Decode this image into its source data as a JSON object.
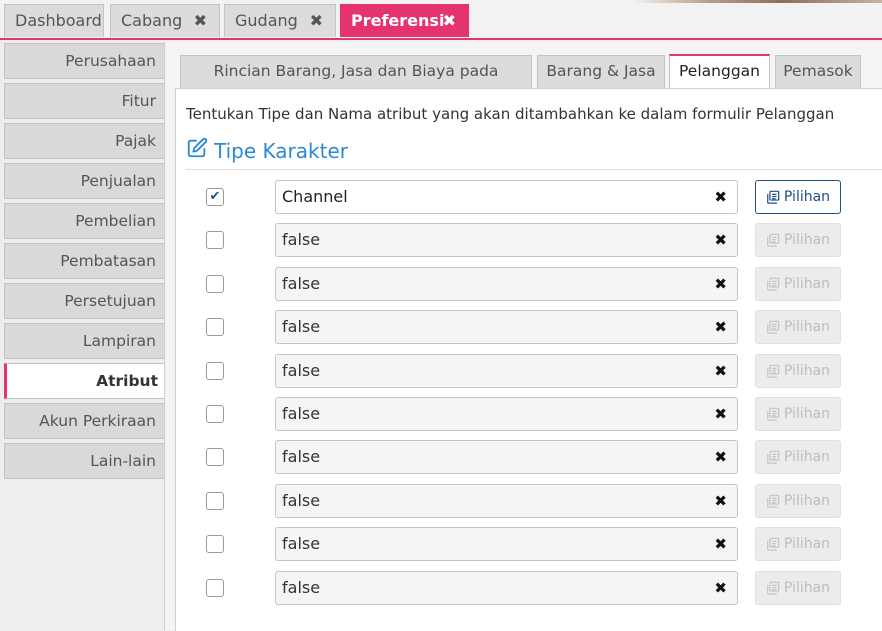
{
  "top_tabs": [
    {
      "label": "Dashboard",
      "closable": false
    },
    {
      "label": "Cabang",
      "closable": true
    },
    {
      "label": "Gudang",
      "closable": true
    },
    {
      "label": "Preferensi",
      "closable": true,
      "active": true
    }
  ],
  "close_glyph": "✖",
  "sidebar": {
    "items": [
      {
        "label": "Perusahaan"
      },
      {
        "label": "Fitur"
      },
      {
        "label": "Pajak"
      },
      {
        "label": "Penjualan"
      },
      {
        "label": "Pembelian"
      },
      {
        "label": "Pembatasan"
      },
      {
        "label": "Persetujuan"
      },
      {
        "label": "Lampiran"
      },
      {
        "label": "Atribut Tambahan",
        "active": true
      },
      {
        "label": "Akun Perkiraan"
      },
      {
        "label": "Lain-lain"
      }
    ]
  },
  "sub_tabs": [
    {
      "label": "Rincian Barang, Jasa dan Biaya pada Formulir"
    },
    {
      "label": "Barang & Jasa"
    },
    {
      "label": "Pelanggan",
      "active": true
    },
    {
      "label": "Pemasok"
    }
  ],
  "main": {
    "description": "Tentukan Tipe dan Nama atribut yang akan ditambahkan ke dalam formulir Pelanggan",
    "section_title": "Tipe Karakter",
    "section_icon": "edit-icon",
    "clear_glyph": "✖",
    "check_glyph": "✔",
    "rows": [
      {
        "checked": true,
        "value": "Channel",
        "button": "Pilihan",
        "enabled": true
      },
      {
        "checked": false,
        "value": "false",
        "button": "Pilihan",
        "enabled": false
      },
      {
        "checked": false,
        "value": "false",
        "button": "Pilihan",
        "enabled": false
      },
      {
        "checked": false,
        "value": "false",
        "button": "Pilihan",
        "enabled": false
      },
      {
        "checked": false,
        "value": "false",
        "button": "Pilihan",
        "enabled": false
      },
      {
        "checked": false,
        "value": "false",
        "button": "Pilihan",
        "enabled": false
      },
      {
        "checked": false,
        "value": "false",
        "button": "Pilihan",
        "enabled": false
      },
      {
        "checked": false,
        "value": "false",
        "button": "Pilihan",
        "enabled": false
      },
      {
        "checked": false,
        "value": "false",
        "button": "Pilihan",
        "enabled": false
      },
      {
        "checked": false,
        "value": "false",
        "button": "Pilihan",
        "enabled": false
      }
    ]
  },
  "colors": {
    "accent": "#e5336f",
    "link_blue": "#2b8ad6",
    "button_blue": "#1f4e8f"
  }
}
